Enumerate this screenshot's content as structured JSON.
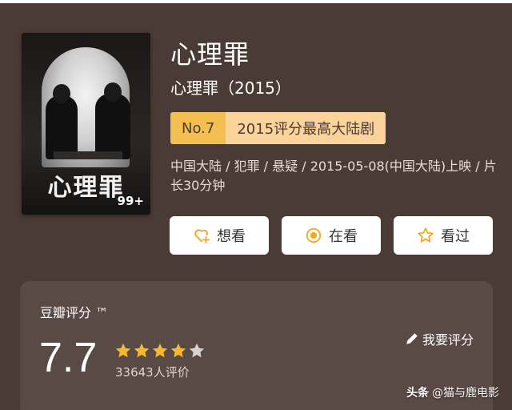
{
  "movie": {
    "title": "心理罪",
    "subtitle": "心理罪（2015）",
    "rank": {
      "no": "No.7",
      "text": "2015评分最高大陆剧"
    },
    "meta": "中国大陆 / 犯罪 / 悬疑 / 2015-05-08(中国大陆)上映 / 片长30分钟",
    "poster": {
      "title": "心理罪",
      "badge": "99+",
      "icon": "poster-image"
    }
  },
  "actions": [
    {
      "label": "想看",
      "icon": "heart-plus-icon"
    },
    {
      "label": "在看",
      "icon": "target-circle-icon"
    },
    {
      "label": "看过",
      "icon": "star-outline-icon"
    }
  ],
  "rating": {
    "label": "豆瓣评分 ™",
    "score": "7.7",
    "stars_filled": 4,
    "stars_total": 5,
    "votes": "33643人评价",
    "rate_link": "我要评分"
  },
  "watermark": {
    "brand": "头条",
    "account": "@猫与鹿电影"
  },
  "colors": {
    "background": "#4b3b37",
    "card": "#5a4a46",
    "accent": "#f3bf50",
    "star": "#f5b82e"
  }
}
